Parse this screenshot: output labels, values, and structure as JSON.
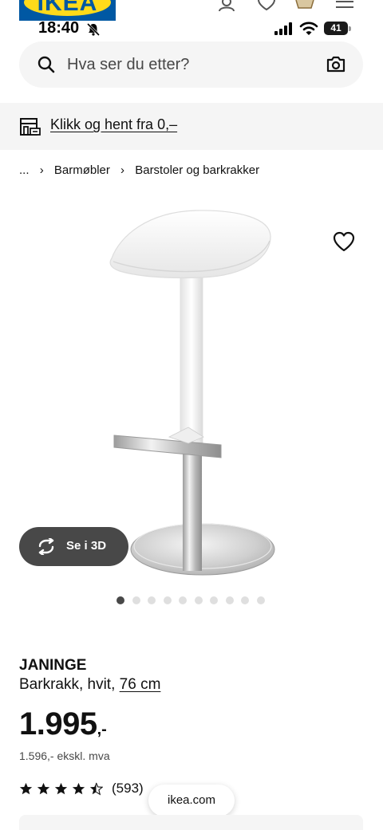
{
  "browser": {
    "logo_text": "IKEA",
    "top_icons": [
      "profile-icon",
      "heart-icon",
      "basket-icon",
      "menu-icon"
    ]
  },
  "status_bar": {
    "time": "18:40",
    "battery": "41"
  },
  "search": {
    "placeholder": "Hva ser du etter?"
  },
  "pickup": {
    "label": "Klikk og hent fra 0,–"
  },
  "breadcrumb": {
    "root": "...",
    "items": [
      "Barmøbler",
      "Barstoler og barkrakker"
    ]
  },
  "gallery": {
    "button_3d_label": "Se i 3D",
    "image_count": 10,
    "active_index": 0
  },
  "product": {
    "name": "JANINGE",
    "description": "Barkrakk, hvit, ",
    "size": "76 cm",
    "price": "1.995",
    "price_suffix": ",-",
    "price_excl_vat": "1.596,- ekskl. mva",
    "rating": 4.5,
    "rating_count": "(593)"
  },
  "browser_footer": {
    "domain": "ikea.com"
  },
  "colors": {
    "brand_blue": "#0058a3",
    "brand_yellow": "#ffda1a",
    "text": "#111111",
    "muted_bg": "#f5f5f5",
    "dark_button": "#484848"
  }
}
